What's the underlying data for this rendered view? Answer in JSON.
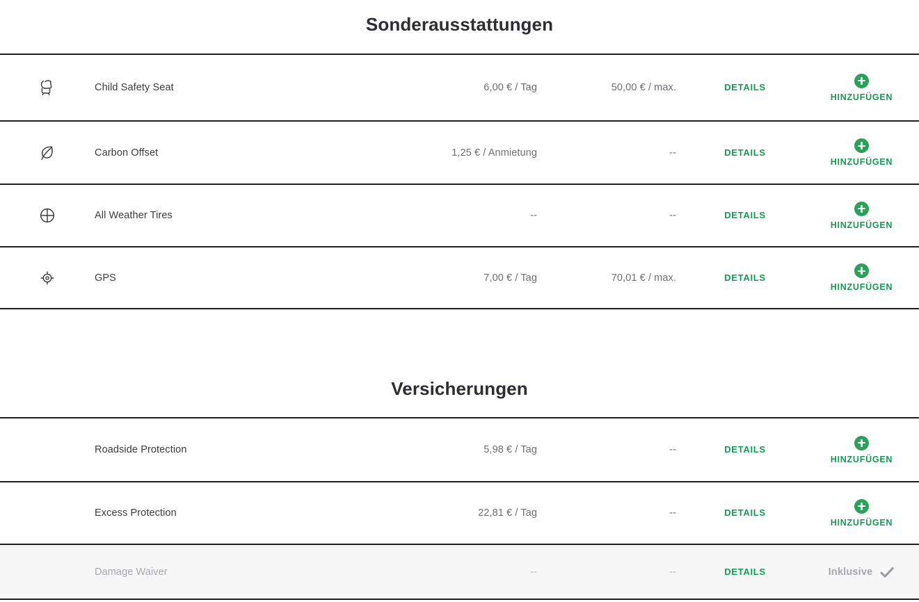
{
  "sections": [
    {
      "key": "extras",
      "title": "Sonderausstattungen",
      "rows": [
        {
          "icon": "child-safety-seat-icon",
          "name": "Child Safety Seat",
          "price_day": "6,00 € / Tag",
          "price_max": "50,00 € / max.",
          "details_label": "DETAILS",
          "action_label": "HINZUFÜGEN",
          "state": "available"
        },
        {
          "icon": "leaf-icon",
          "name": "Carbon Offset",
          "price_day": "1,25 € / Anmietung",
          "price_max": "--",
          "details_label": "DETAILS",
          "action_label": "HINZUFÜGEN",
          "state": "available"
        },
        {
          "icon": "tire-icon",
          "name": "All Weather Tires",
          "price_day": "--",
          "price_max": "--",
          "details_label": "DETAILS",
          "action_label": "HINZUFÜGEN",
          "state": "available"
        },
        {
          "icon": "gps-target-icon",
          "name": "GPS",
          "price_day": "7,00 € / Tag",
          "price_max": "70,01 € / max.",
          "details_label": "DETAILS",
          "action_label": "HINZUFÜGEN",
          "state": "available"
        }
      ]
    },
    {
      "key": "insurance",
      "title": "Versicherungen",
      "rows": [
        {
          "icon": "none",
          "name": "Roadside Protection",
          "price_day": "5,98 € / Tag",
          "price_max": "--",
          "details_label": "DETAILS",
          "action_label": "HINZUFÜGEN",
          "state": "available"
        },
        {
          "icon": "none",
          "name": "Excess Protection",
          "price_day": "22,81 € / Tag",
          "price_max": "--",
          "details_label": "DETAILS",
          "action_label": "HINZUFÜGEN",
          "state": "available"
        },
        {
          "icon": "none",
          "name": "Damage Waiver",
          "price_day": "--",
          "price_max": "--",
          "details_label": "DETAILS",
          "action_label": "Inklusive",
          "state": "included"
        }
      ]
    }
  ],
  "colors": {
    "accent_green": "#159a55",
    "plus_green": "#2e9e5b",
    "text_dark": "#3b3b41",
    "text_muted": "#6d6d74",
    "disabled_grey": "#a7a7ad",
    "row_included_bg": "#f7f7f7",
    "rule": "#1d1d1f"
  }
}
